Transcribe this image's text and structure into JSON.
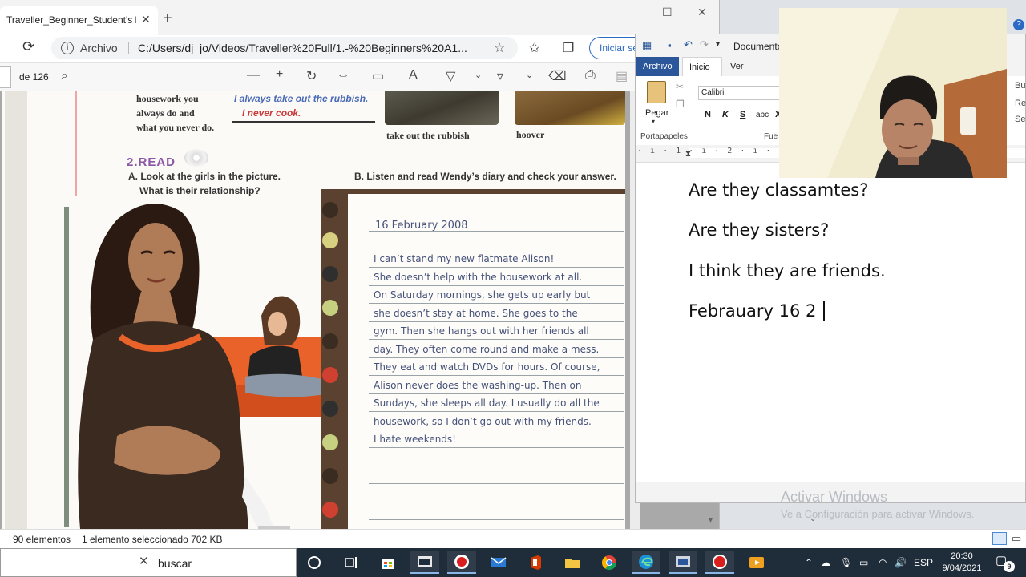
{
  "edge": {
    "tab_title": "Traveller_Beginner_Student's boo",
    "tab_close": "✕",
    "new_tab": "+",
    "window_controls": {
      "minimize": "—",
      "maximize": "☐",
      "close": "✕"
    },
    "site_label": "Archivo",
    "url": "C:/Users/dj_jo/Videos/Traveller%20Full/1.-%20Beginners%20A1...",
    "signin_label": "Iniciar se",
    "pdf_pagecount": "de 126"
  },
  "pdf_page": {
    "housework_lines": [
      "housework you",
      "always do and",
      "what you never do."
    ],
    "always_text": "I always take out the rubbish.",
    "never_cook": "I never cook.",
    "caption_rubbish": "take out the rubbish",
    "caption_hoover": "hoover",
    "read_heading": "2.READ",
    "instruction_a1": "A. Look at the girls in the picture.",
    "instruction_a2": "What is their relationship?",
    "instruction_b": "B. Listen and read Wendy’s diary and check your answer.",
    "diary_date": "16 February 2008",
    "diary_lines": [
      "I can’t stand my new flatmate Alison!",
      "She doesn’t help with the housework at all.",
      "On Saturday mornings, she gets up early but",
      "she doesn’t stay at home. She goes to the",
      "gym. Then she hangs out with her friends all",
      "day. They often come round and make a mess.",
      "They eat and watch DVDs for hours. Of course,",
      "Alison never does the washing-up. Then on",
      "Sundays, she sleeps all day. I usually do all the",
      "housework, so I don’t go out with my friends.",
      "I hate weekends!"
    ]
  },
  "word": {
    "doc_title": "Documento",
    "tabs": {
      "archivo": "Archivo",
      "inicio": "Inicio",
      "ver": "Ver"
    },
    "paste_label": "Pegar",
    "group_clipboard": "Portapapeles",
    "font_name": "Calibri",
    "format_buttons": [
      "N",
      "K",
      "S",
      "abc",
      "X"
    ],
    "group_font": "Fue",
    "ruler": "· ı · 1 · ı · 2 · ı · 3",
    "doc_lines": [
      "Are they classamtes?",
      "Are they sisters?",
      "I think they are friends.",
      "Febrauary 16 2"
    ]
  },
  "right_partial": [
    "Bu",
    "Re",
    "Se"
  ],
  "activation": {
    "line1": "Activar Windows",
    "line2": "Ve a Configuración para activar Windows."
  },
  "explorer_status": {
    "items": "90 elementos",
    "selected": "1 elemento seleccionado  702 KB"
  },
  "taskbar": {
    "search_text": "buscar",
    "language": "ESP",
    "time": "20:30",
    "date": "9/04/2021",
    "notification_count": "9"
  }
}
